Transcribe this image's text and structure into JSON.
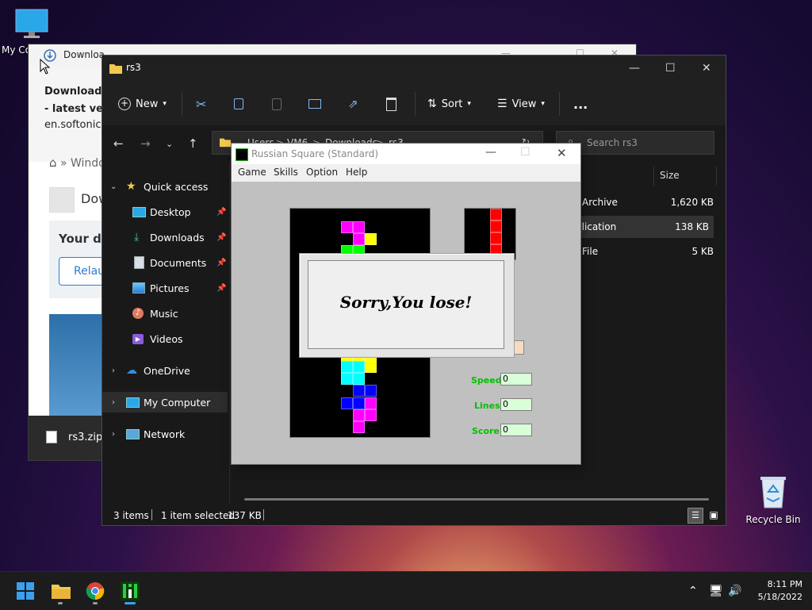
{
  "desktop": {
    "my_computer_label": "My Co",
    "recycle_bin_label": "Recycle Bin"
  },
  "browser": {
    "tab_title": "Downloa",
    "notif_line1": "Download R",
    "notif_line2": "- latest versi",
    "notif_line3": "en.softonic.c",
    "breadcrumb": "» Windo",
    "heading_fragment": "Dow",
    "your_download": "Your do",
    "relaunch": "Relau",
    "download_file": "rs3.zip"
  },
  "explorer": {
    "title": "rs3",
    "toolbar": {
      "new": "New",
      "sort": "Sort",
      "view": "View",
      "more": "..."
    },
    "address": {
      "parts": [
        "Users",
        ">",
        "VM6",
        ">",
        "Downloads",
        ">",
        "rs3"
      ]
    },
    "search_placeholder": "Search rs3",
    "sidebar": {
      "quick_access": "Quick access",
      "items": [
        {
          "label": "Desktop",
          "pinned": true
        },
        {
          "label": "Downloads",
          "pinned": true
        },
        {
          "label": "Documents",
          "pinned": true
        },
        {
          "label": "Pictures",
          "pinned": true
        },
        {
          "label": "Music",
          "pinned": false
        },
        {
          "label": "Videos",
          "pinned": false
        }
      ],
      "onedrive": "OneDrive",
      "my_computer": "My Computer",
      "network": "Network"
    },
    "columns": {
      "type_fragment": "e",
      "size": "Size"
    },
    "rows": [
      {
        "type": "Archive",
        "size": "1,620 KB"
      },
      {
        "type": "plication",
        "size": "138 KB"
      },
      {
        "type": "File",
        "size": "5 KB"
      }
    ],
    "status": {
      "items": "3 items",
      "selected": "1 item selected",
      "selected_size": "137 KB"
    }
  },
  "game": {
    "title": "Russian Square (Standard)",
    "menu": [
      "Game",
      "Skills",
      "Option",
      "Help"
    ],
    "speed_label": "Speed",
    "speed_value": "0",
    "lines_label": "Lines",
    "lines_value": "0",
    "score_label": "Score",
    "score_value": "0",
    "dialog_message": "Sorry,You lose!"
  },
  "taskbar": {
    "time": "8:11 PM",
    "date": "5/18/2022"
  },
  "colors": {
    "magenta": "#ff00ff",
    "green": "#00ff00",
    "cyan": "#00ffff",
    "yellow": "#ffff00",
    "blue": "#0000ff",
    "red": "#ff0000",
    "label_green": "#00c000"
  }
}
